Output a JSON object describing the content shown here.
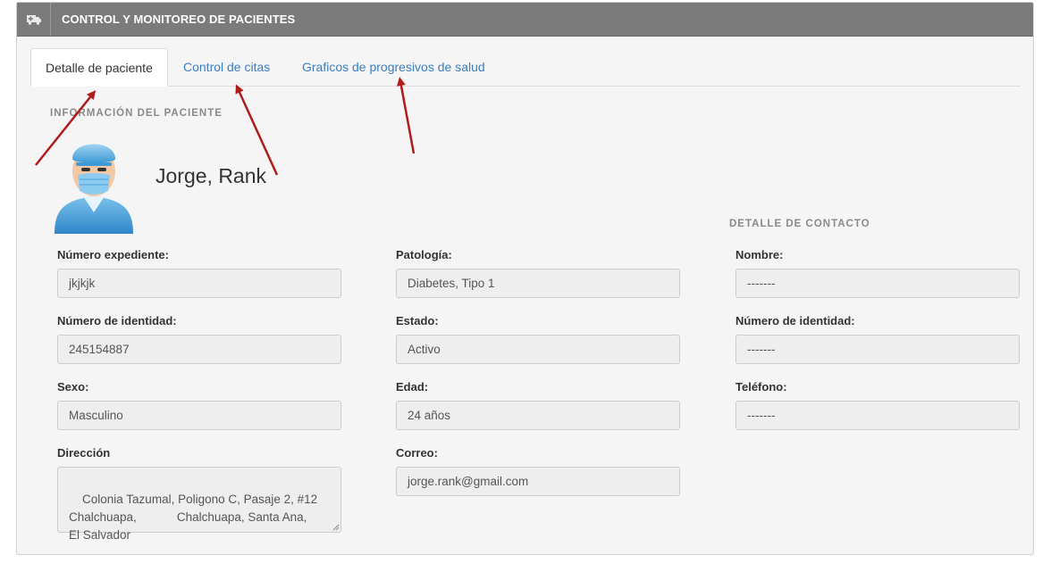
{
  "panel": {
    "title": "CONTROL Y MONITOREO DE PACIENTES",
    "icon": "ambulance-icon"
  },
  "tabs": [
    {
      "label": "Detalle de paciente",
      "active": true
    },
    {
      "label": "Control de citas",
      "active": false
    },
    {
      "label": "Graficos de progresivos de salud",
      "active": false
    }
  ],
  "patient_section": {
    "title": "INFORMACIÓN DEL PACIENTE",
    "name": "Jorge, Rank",
    "avatar_icon": "doctor-avatar-icon"
  },
  "contact_section": {
    "title": "DETALLE DE CONTACTO"
  },
  "fields": {
    "expediente": {
      "label": "Número expediente:",
      "value": "jkjkjk"
    },
    "identidad": {
      "label": "Número de identidad:",
      "value": "245154887"
    },
    "sexo": {
      "label": "Sexo:",
      "value": "Masculino"
    },
    "direccion": {
      "label": "Dirección",
      "value": "Colonia Tazumal, Poligono C, Pasaje 2, #12\nChalchuapa,            Chalchuapa, Santa Ana,\nEl Salvador"
    },
    "patologia": {
      "label": "Patología:",
      "value": "Diabetes, Tipo 1"
    },
    "estado": {
      "label": "Estado:",
      "value": "Activo"
    },
    "edad": {
      "label": "Edad:",
      "value": "24 años"
    },
    "correo": {
      "label": "Correo:",
      "value": "jorge.rank@gmail.com"
    },
    "contacto_nombre": {
      "label": "Nombre:",
      "value": "-------"
    },
    "contacto_identidad": {
      "label": "Número de identidad:",
      "value": "-------"
    },
    "contacto_telefono": {
      "label": "Teléfono:",
      "value": "-------"
    }
  },
  "colors": {
    "header_bg": "#7b7b7b",
    "link": "#3a7ec2",
    "arrow": "#b01c1c",
    "panel_bg": "#f5f5f5"
  }
}
